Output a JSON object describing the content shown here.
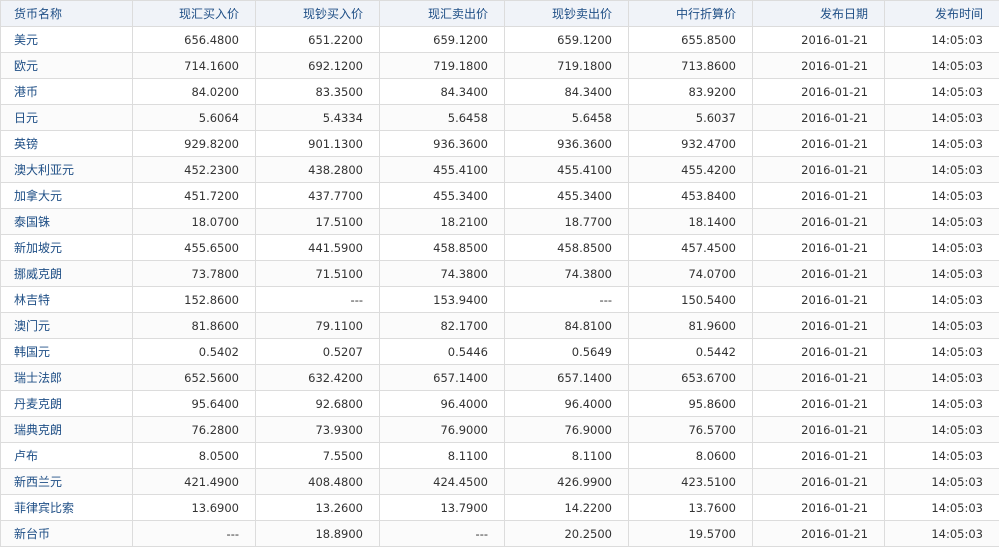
{
  "headers": [
    "货币名称",
    "现汇买入价",
    "现钞买入价",
    "现汇卖出价",
    "现钞卖出价",
    "中行折算价",
    "发布日期",
    "发布时间"
  ],
  "rows": [
    [
      "美元",
      "656.4800",
      "651.2200",
      "659.1200",
      "659.1200",
      "655.8500",
      "2016-01-21",
      "14:05:03"
    ],
    [
      "欧元",
      "714.1600",
      "692.1200",
      "719.1800",
      "719.1800",
      "713.8600",
      "2016-01-21",
      "14:05:03"
    ],
    [
      "港币",
      "84.0200",
      "83.3500",
      "84.3400",
      "84.3400",
      "83.9200",
      "2016-01-21",
      "14:05:03"
    ],
    [
      "日元",
      "5.6064",
      "5.4334",
      "5.6458",
      "5.6458",
      "5.6037",
      "2016-01-21",
      "14:05:03"
    ],
    [
      "英镑",
      "929.8200",
      "901.1300",
      "936.3600",
      "936.3600",
      "932.4700",
      "2016-01-21",
      "14:05:03"
    ],
    [
      "澳大利亚元",
      "452.2300",
      "438.2800",
      "455.4100",
      "455.4100",
      "455.4200",
      "2016-01-21",
      "14:05:03"
    ],
    [
      "加拿大元",
      "451.7200",
      "437.7700",
      "455.3400",
      "455.3400",
      "453.8400",
      "2016-01-21",
      "14:05:03"
    ],
    [
      "泰国铢",
      "18.0700",
      "17.5100",
      "18.2100",
      "18.7700",
      "18.1400",
      "2016-01-21",
      "14:05:03"
    ],
    [
      "新加坡元",
      "455.6500",
      "441.5900",
      "458.8500",
      "458.8500",
      "457.4500",
      "2016-01-21",
      "14:05:03"
    ],
    [
      "挪威克朗",
      "73.7800",
      "71.5100",
      "74.3800",
      "74.3800",
      "74.0700",
      "2016-01-21",
      "14:05:03"
    ],
    [
      "林吉特",
      "152.8600",
      "---",
      "153.9400",
      "---",
      "150.5400",
      "2016-01-21",
      "14:05:03"
    ],
    [
      "澳门元",
      "81.8600",
      "79.1100",
      "82.1700",
      "84.8100",
      "81.9600",
      "2016-01-21",
      "14:05:03"
    ],
    [
      "韩国元",
      "0.5402",
      "0.5207",
      "0.5446",
      "0.5649",
      "0.5442",
      "2016-01-21",
      "14:05:03"
    ],
    [
      "瑞士法郎",
      "652.5600",
      "632.4200",
      "657.1400",
      "657.1400",
      "653.6700",
      "2016-01-21",
      "14:05:03"
    ],
    [
      "丹麦克朗",
      "95.6400",
      "92.6800",
      "96.4000",
      "96.4000",
      "95.8600",
      "2016-01-21",
      "14:05:03"
    ],
    [
      "瑞典克朗",
      "76.2800",
      "73.9300",
      "76.9000",
      "76.9000",
      "76.5700",
      "2016-01-21",
      "14:05:03"
    ],
    [
      "卢布",
      "8.0500",
      "7.5500",
      "8.1100",
      "8.1100",
      "8.0600",
      "2016-01-21",
      "14:05:03"
    ],
    [
      "新西兰元",
      "421.4900",
      "408.4800",
      "424.4500",
      "426.9900",
      "423.5100",
      "2016-01-21",
      "14:05:03"
    ],
    [
      "菲律宾比索",
      "13.6900",
      "13.2600",
      "13.7900",
      "14.2200",
      "13.7600",
      "2016-01-21",
      "14:05:03"
    ],
    [
      "新台币",
      "---",
      "18.8900",
      "---",
      "20.2500",
      "19.5700",
      "2016-01-21",
      "14:05:03"
    ]
  ]
}
